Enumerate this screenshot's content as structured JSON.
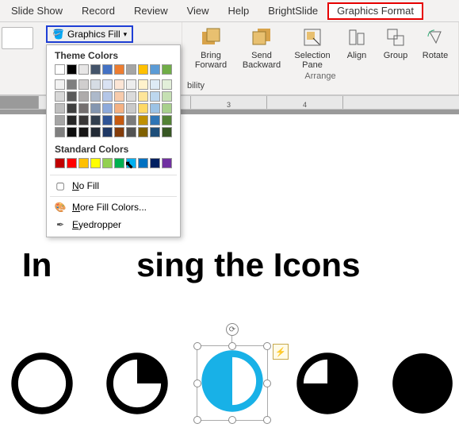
{
  "tabs": {
    "slide_show": "Slide Show",
    "record": "Record",
    "review": "Review",
    "view": "View",
    "help": "Help",
    "brightslide": "BrightSlide",
    "graphics_format": "Graphics Format"
  },
  "ribbon": {
    "fill_button": "Graphics Fill",
    "bring_forward": "Bring\nForward",
    "send_backward": "Send\nBackward",
    "selection_pane": "Selection\nPane",
    "align": "Align",
    "group": "Group",
    "rotate": "Rotate",
    "arrange_label": "Arrange",
    "bility_fragment": "bility"
  },
  "dropdown": {
    "theme_title": "Theme Colors",
    "standard_title": "Standard Colors",
    "no_fill": "No Fill",
    "more_colors": "More Fill Colors...",
    "eyedropper": "Eyedropper",
    "theme_row1": [
      "#ffffff",
      "#000000",
      "#e7e6e6",
      "#44546a",
      "#4472c4",
      "#ed7d31",
      "#a5a5a5",
      "#ffc000",
      "#5b9bd5",
      "#70ad47"
    ],
    "theme_shades": [
      [
        "#f2f2f2",
        "#7f7f7f",
        "#d0cece",
        "#d6dce4",
        "#d9e2f3",
        "#fbe5d5",
        "#ededed",
        "#fff2cc",
        "#deebf6",
        "#e2efd9"
      ],
      [
        "#d8d8d8",
        "#595959",
        "#aeabab",
        "#adb9ca",
        "#b4c6e7",
        "#f7cbac",
        "#dbdbdb",
        "#fee599",
        "#bdd7ee",
        "#c5e0b3"
      ],
      [
        "#bfbfbf",
        "#3f3f3f",
        "#757070",
        "#8496b0",
        "#8eaadb",
        "#f4b183",
        "#c9c9c9",
        "#ffd965",
        "#9cc3e5",
        "#a8d08d"
      ],
      [
        "#a5a5a5",
        "#262626",
        "#3a3838",
        "#323f4f",
        "#2f5496",
        "#c55a11",
        "#7b7b7b",
        "#bf9000",
        "#2e75b5",
        "#538135"
      ],
      [
        "#7f7f7f",
        "#0c0c0c",
        "#171616",
        "#222a35",
        "#1f3864",
        "#833c0b",
        "#525252",
        "#7f6000",
        "#1e4e79",
        "#375623"
      ]
    ],
    "standard_colors": [
      "#c00000",
      "#ff0000",
      "#ffc000",
      "#ffff00",
      "#92d050",
      "#00b050",
      "#00b0f0",
      "#0070c0",
      "#002060",
      "#7030a0"
    ]
  },
  "ruler": {
    "n3": "3",
    "n4": "4"
  },
  "slide": {
    "title_fragment": "Insert      using the Icons"
  },
  "selected_shape": {
    "fill_color": "#18b1e7"
  }
}
